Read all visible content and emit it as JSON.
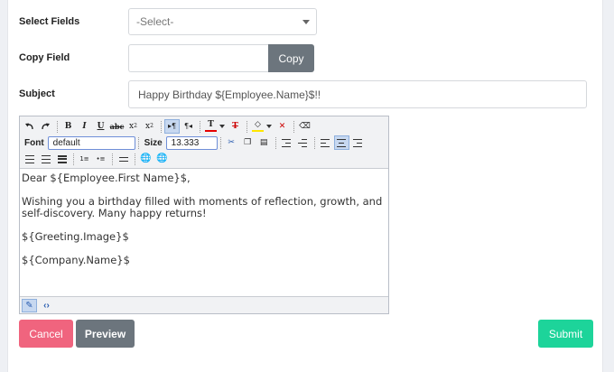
{
  "form": {
    "select_fields_label": "Select Fields",
    "select_value": "-Select-",
    "copy_field_label": "Copy Field",
    "copy_field_value": "",
    "copy_button": "Copy",
    "subject_label": "Subject",
    "subject_value": "Happy Birthday ${Employee.Name}$!!"
  },
  "editor": {
    "toolbar": {
      "font_label": "Font",
      "font_value": "default",
      "size_label": "Size",
      "size_value": "13.333",
      "icons": [
        "undo-icon",
        "redo-icon",
        "bold-icon",
        "italic-icon",
        "underline-icon",
        "strikethrough-icon",
        "subscript-icon",
        "superscript-icon",
        "ltr-icon",
        "rtl-icon",
        "text-color-icon",
        "remove-text-color-icon",
        "highlight-color-icon",
        "remove-highlight-icon",
        "eraser-icon",
        "cut-icon",
        "copy-icon",
        "paste-icon",
        "indent-icon",
        "outdent-icon",
        "align-left-icon",
        "align-center-icon",
        "align-right-icon",
        "align-justify-icon",
        "justify-full-icon",
        "ordered-list-icon",
        "unordered-list-icon",
        "horizontal-rule-icon",
        "link-icon",
        "unlink-icon"
      ]
    },
    "body_lines": [
      "Dear ${Employee.First Name}$,",
      "Wishing you a birthday filled with moments of reflection, growth, and self-discovery. Many happy returns!",
      "${Greeting.Image}$",
      "${Company.Name}$"
    ],
    "modes": [
      "design-mode-icon",
      "html-mode-icon"
    ]
  },
  "actions": {
    "cancel": "Cancel",
    "preview": "Preview",
    "submit": "Submit"
  },
  "colors": {
    "cancel": "#f0647e",
    "preview": "#6c757d",
    "submit": "#1dd49a",
    "text_color_bar": "#e60000",
    "highlight_bar": "#ffe600"
  }
}
